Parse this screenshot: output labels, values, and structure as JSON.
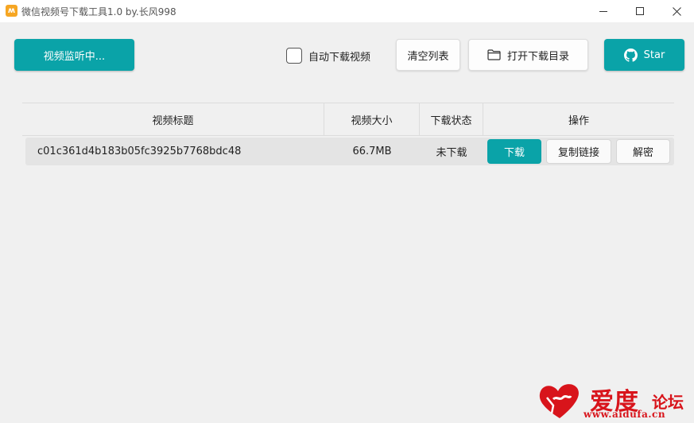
{
  "window": {
    "title": "微信视频号下载工具1.0 by.长风998",
    "icon": "app-logo-icon"
  },
  "toolbar": {
    "monitor_label": "视频监听中...",
    "auto_download_label": "自动下载视频",
    "auto_download_checked": false,
    "clear_label": "清空列表",
    "open_dir_label": "打开下载目录",
    "star_label": "Star"
  },
  "table": {
    "columns": [
      "视频标题",
      "视频大小",
      "下载状态",
      "操作"
    ],
    "rows": [
      {
        "title": "c01c361d4b183b05fc3925b7768bdc48",
        "size": "66.7MB",
        "status": "未下载",
        "actions": [
          "下载",
          "复制链接",
          "解密"
        ]
      }
    ]
  },
  "watermark": {
    "text_large": "爱度",
    "text_small": "论坛",
    "url": "www.aidufa.cn"
  },
  "colors": {
    "accent": "#0aa3a8",
    "background": "#f0f0f0",
    "watermark": "#d8141b"
  }
}
